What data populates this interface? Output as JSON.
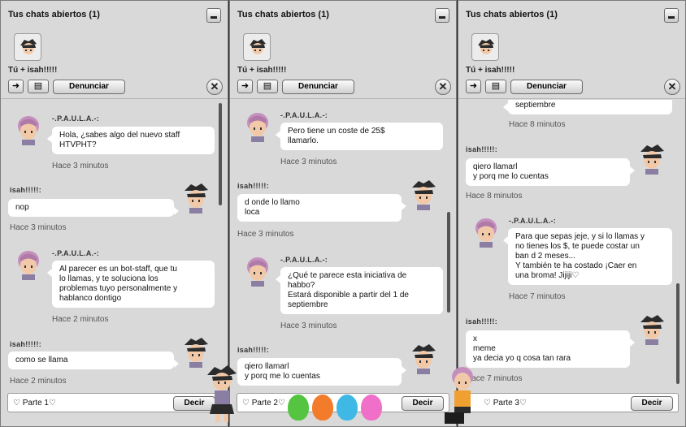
{
  "windows": [
    {
      "title": "Tus chats abiertos (1)",
      "with_label": "Tú + isah!!!!!",
      "report_label": "Denunciar",
      "input_text": "♡ Parte 1♡",
      "say_label": "Decir",
      "messages": [
        {
          "sender": "-.P.A.U.L.A.-:",
          "text": "Hola, ¿sabes algo del nuevo staff\nHTVPHT?",
          "time": "Hace 3 minutos",
          "side": "left"
        },
        {
          "sender": "isah!!!!!:",
          "text": "nop",
          "time": "Hace 3 minutos",
          "side": "right"
        },
        {
          "sender": "-.P.A.U.L.A.-:",
          "text": "Al parecer es un bot-staff, que tu\nlo llamas, y te soluciona los\nproblemas tuyo personalmente y\nhablanco dontigo",
          "time": "Hace 2 minutos",
          "side": "left"
        },
        {
          "sender": "isah!!!!!:",
          "text": "como se llama",
          "time": "Hace 2 minutos",
          "side": "right"
        }
      ]
    },
    {
      "title": "Tus chats abiertos (1)",
      "with_label": "Tú + isah!!!!!",
      "report_label": "Denunciar",
      "input_text": "♡ Parte 2♡",
      "say_label": "Decir",
      "messages": [
        {
          "sender": "-.P.A.U.L.A.-:",
          "text": "Pero tiene un coste de 25$\nllamarlo.",
          "time": "Hace 3 minutos",
          "side": "left"
        },
        {
          "sender": "isah!!!!!:",
          "text": "d onde lo llamo\nloca",
          "time": "Hace 3 minutos",
          "side": "right"
        },
        {
          "sender": "-.P.A.U.L.A.-:",
          "text": "¿Qué te parece esta iniciativa de\nhabbo?\nEstará disponible a partir del 1 de\nseptiembre",
          "time": "Hace 3 minutos",
          "side": "left"
        },
        {
          "sender": "isah!!!!!:",
          "text": "qiero llamarl\ny porq me lo cuentas",
          "time": "",
          "side": "right"
        }
      ]
    },
    {
      "title": "Tus chats abiertos (1)",
      "with_label": "Tú + isah!!!!!",
      "report_label": "Denunciar",
      "input_text": "♡ Parte 3♡",
      "say_label": "Decir",
      "messages": [
        {
          "sender": "",
          "text": "septiembre",
          "time": "Hace 8 minutos",
          "side": "left"
        },
        {
          "sender": "isah!!!!!:",
          "text": "qiero llamarl\ny porq me lo cuentas",
          "time": "Hace 8 minutos",
          "side": "right"
        },
        {
          "sender": "-.P.A.U.L.A.-:",
          "text": "Para que sepas jeje, y si lo llamas y\nno tienes los $, te puede costar un\nban d 2 meses...\nY también te ha costado ¡Caer en\nuna broma! Jijiji♡",
          "time": "Hace 7 minutos",
          "side": "left"
        },
        {
          "sender": "isah!!!!!:",
          "text": "x\nmeme\nya decia yo q cosa tan rara",
          "time": "Hace 7 minutos",
          "side": "right"
        }
      ]
    }
  ],
  "colors": {
    "panel": "#d9d9d9",
    "bubble": "#ffffff",
    "paula_skin": "#f2c9a8",
    "paula_hair": "#c58fbd",
    "isah_hair": "#2b2b2b",
    "isah_shirt": "#8a7fa3",
    "balloons": [
      "#54c441",
      "#f27c2a",
      "#3fb8e6",
      "#f06fc8"
    ]
  }
}
